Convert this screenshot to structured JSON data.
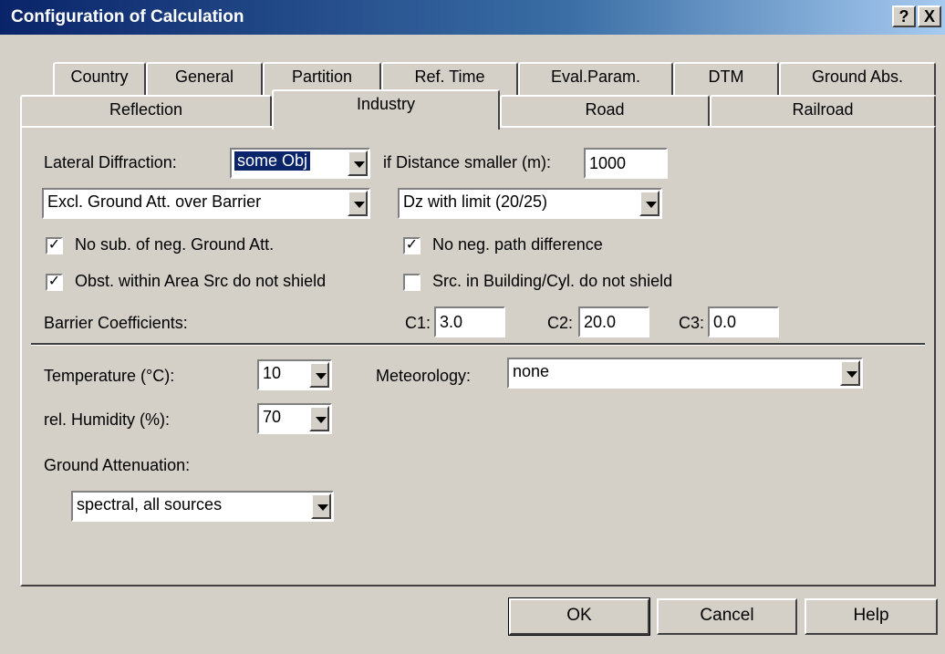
{
  "window": {
    "title": "Configuration of Calculation",
    "help_button": "?",
    "close_button": "X"
  },
  "tabs_row1": [
    "Country",
    "General",
    "Partition",
    "Ref. Time",
    "Eval.Param.",
    "DTM",
    "Ground Abs."
  ],
  "tabs_row2": [
    "Reflection",
    "Industry",
    "Road",
    "Railroad"
  ],
  "active_tab": "Industry",
  "industry": {
    "lateral_diffraction_label": "Lateral Diffraction:",
    "lateral_diffraction_value": "some Obj",
    "distance_label": "if Distance smaller (m):",
    "distance_value": "1000",
    "ground_att_combo_value": "Excl. Ground Att. over Barrier",
    "dz_combo_value": "Dz with limit (20/25)",
    "chk_no_sub_label": "No sub. of neg. Ground Att.",
    "chk_no_sub_checked": true,
    "chk_no_neg_path_label": "No neg. path difference",
    "chk_no_neg_path_checked": true,
    "chk_obst_label": "Obst. within Area Src do not shield",
    "chk_obst_checked": true,
    "chk_src_building_label": "Src. in Building/Cyl. do not shield",
    "chk_src_building_checked": false,
    "barrier_coeff_label": "Barrier Coefficients:",
    "c1_label": "C1:",
    "c1_value": "3.0",
    "c2_label": "C2:",
    "c2_value": "20.0",
    "c3_label": "C3:",
    "c3_value": "0.0",
    "temperature_label": "Temperature (°C):",
    "temperature_value": "10",
    "meteorology_label": "Meteorology:",
    "meteorology_value": "none",
    "humidity_label": "rel. Humidity (%):",
    "humidity_value": "70",
    "ground_attenuation_label": "Ground Attenuation:",
    "ground_attenuation_value": "spectral, all sources"
  },
  "buttons": {
    "ok": "OK",
    "cancel": "Cancel",
    "help": "Help"
  },
  "colors": {
    "dialog_bg": "#d4d0c8",
    "titlebar_start": "#0a246a",
    "titlebar_end": "#a6caf0",
    "selection": "#0a246a"
  }
}
